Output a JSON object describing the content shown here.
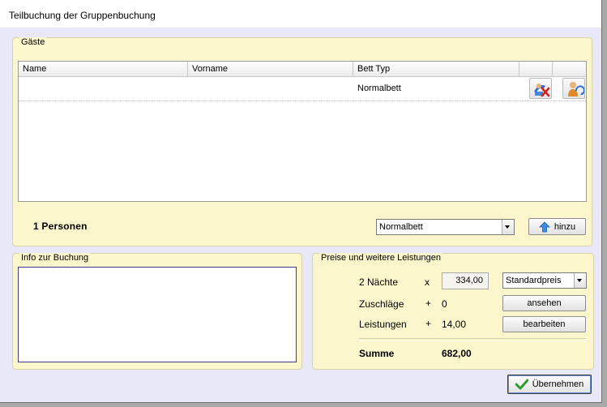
{
  "window": {
    "title": "Teilbuchung der Gruppenbuchung"
  },
  "guests": {
    "group_title": "Gäste",
    "columns": [
      "Name",
      "Vorname",
      "Bett Typ"
    ],
    "rows": [
      {
        "name": "",
        "vorname": "",
        "bett_typ": "Normalbett"
      }
    ],
    "icons": [
      "remove-guest-icon",
      "edit-guest-icon"
    ],
    "count_label": "1 Personen",
    "bed_type_select": {
      "value": "Normalbett"
    },
    "add_button": "hinzu"
  },
  "info": {
    "group_title": "Info zur Buchung",
    "text": ""
  },
  "prices": {
    "group_title": "Preise und weitere Leistungen",
    "nights_label": "2 Nächte",
    "nights_op": "x",
    "nights_price": "334,00",
    "price_type": "Standardpreis",
    "surcharge_label": "Zuschläge",
    "surcharge_op": "+",
    "surcharge_value": "0",
    "view_button": "ansehen",
    "services_label": "Leistungen",
    "services_op": "+",
    "services_value": "14,00",
    "edit_button": "bearbeiten",
    "sum_label": "Summe",
    "sum_value": "682,00"
  },
  "footer": {
    "apply_button": "Übernehmen"
  },
  "colors": {
    "group_bg": "#fcf6cc",
    "window_bg": "#e8e8f8",
    "memo_border": "#3b3b8f"
  }
}
